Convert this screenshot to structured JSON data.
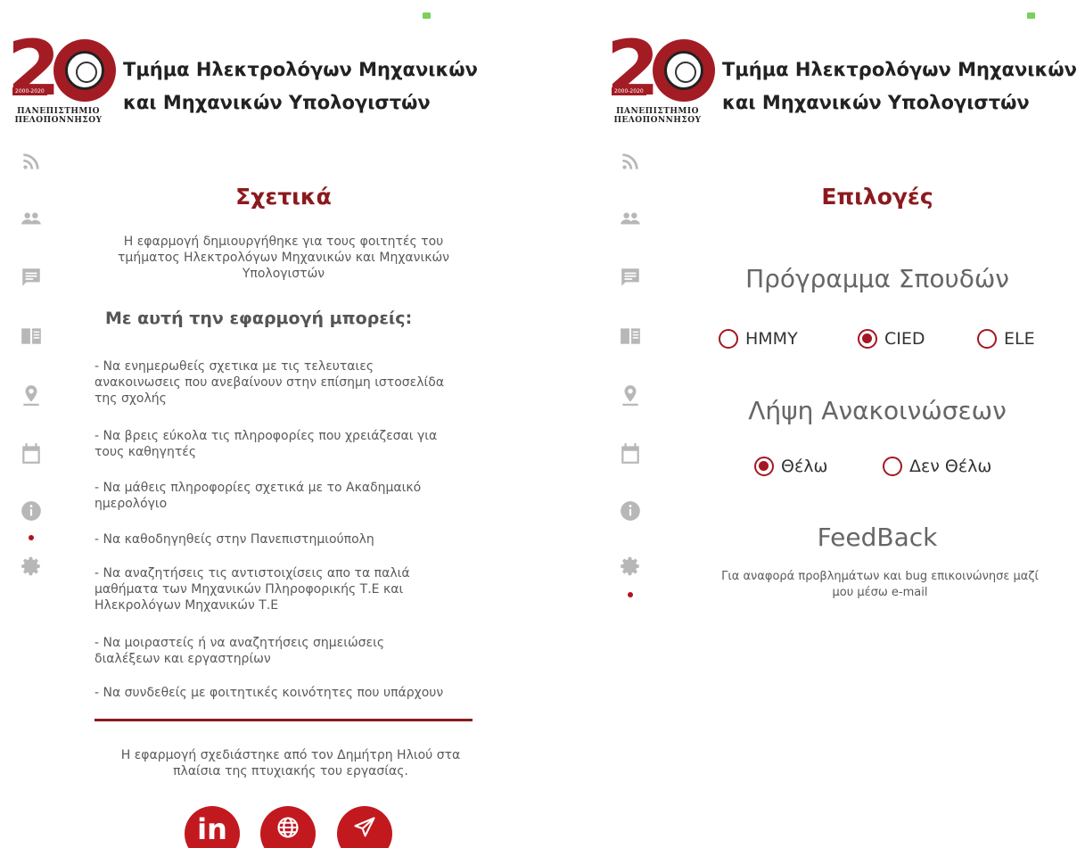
{
  "header": {
    "dept_line1": "Τμήμα Ηλεκτρολόγων Μηχανικών",
    "dept_line2": "και Μηχανικών Υπολογιστών",
    "logo_years": "2000-2020",
    "logo_uni_line1": "ΠΑΝΕΠΙΣΤΗΜΙΟ",
    "logo_uni_line2": "ΠΕΛΟΠΟΝΝΗΣΟΥ"
  },
  "sidebar": {
    "icons": [
      "rss-icon",
      "people-icon",
      "chat-icon",
      "book-icon",
      "location-icon",
      "calendar-icon",
      "info-icon",
      "settings-icon"
    ]
  },
  "about": {
    "title": "Σχετικά",
    "intro": "Η εφαρμογή δημιουργήθηκε για τους φοιτητές του τμήματος Ηλεκτρολόγων Μηχανικών και Μηχανικών Υπολογιστών",
    "intro_lines": [
      "Η εφαρμογή δημιουργήθηκε για τους φοιτητές του",
      "τμήματος Ηλεκτρολόγων Μηχανικών και Μηχανικών",
      "Υπολογιστών"
    ],
    "capabilities_heading": "Με αυτή την εφαρμογή μπορείς:",
    "features": [
      [
        "- Να ενημερωθείς σχετικα με τις τελευταιες",
        "ανακοινωσεις που ανεβαίνουν στην επίσημη ιστοσελίδα",
        "της σχολής"
      ],
      [
        "- Να βρεις εύκολα τις πληροφορίες που χρειάζεσαι για",
        "τους καθηγητές"
      ],
      [
        "- Να μάθεις πληροφορίες σχετικά με το Ακαδημαικό",
        "ημερολόγιο"
      ],
      [
        "- Να καθοδηγηθείς στην Πανεπιστημιούπολη"
      ],
      [
        "- Να αναζητήσεις τις αντιστοιχίσεις απο τα παλιά",
        "μαθήματα των Μηχανικών Πληροφορικής Τ.Ε και",
        "Ηλεκρολόγων Μηχανικών Τ.Ε"
      ],
      [
        "- Να μοιραστείς ή να αναζητήσεις σημειώσεις",
        "διαλέξεων και εργαστηρίων"
      ],
      [
        "- Να συνδεθείς με φοιτητικές κοινότητες που υπάρχουν"
      ]
    ],
    "credit_lines": [
      "Η εφαρμογή σχεδιάστηκε από τον Δημήτρη Ηλιού στα",
      "πλαίσια της πτυχιακής του εργασίας."
    ],
    "social": {
      "linkedin": "in",
      "web": "globe-icon",
      "email": "send-icon"
    }
  },
  "options": {
    "title": "Επιλογές",
    "program_label": "Πρόγραμμα Σπουδών",
    "program_options": [
      {
        "label": "HMMY",
        "selected": false
      },
      {
        "label": "CIED",
        "selected": true
      },
      {
        "label": "ELE",
        "selected": false
      }
    ],
    "notifications_label": "Λήψη Ανακοινώσεων",
    "notification_options": [
      {
        "label": "Θέλω",
        "selected": true
      },
      {
        "label": "Δεν Θέλω",
        "selected": false
      }
    ],
    "feedback_label": "FeedBack",
    "feedback_lines": [
      "Για αναφορά προβλημάτων και bug επικοινώνησε μαζί",
      "μου μέσω e-mail"
    ]
  },
  "colors": {
    "accent": "#8b1a1f",
    "radio": "#a51722",
    "social": "#c2191f",
    "icon_gray": "#b7b7b7",
    "battery": "#7ccf5a"
  }
}
